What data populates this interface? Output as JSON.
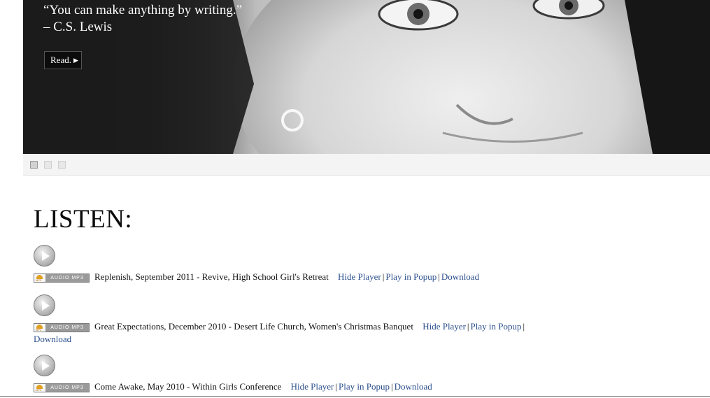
{
  "hero": {
    "quote": "“You can make anything by writing.”",
    "author": "– C.S. Lewis",
    "read_label": "Read.",
    "read_icon": "triangle-right-icon"
  },
  "slider": {
    "dots": [
      {
        "active": true
      },
      {
        "active": false
      },
      {
        "active": false
      }
    ]
  },
  "listen": {
    "title": "LISTEN:",
    "badge_text": "AUDIO MP3",
    "tracks": [
      {
        "title": "Replenish, September 2011 - Revive, High School Girl's Retreat",
        "hide_player": "Hide Player",
        "play_popup": "Play in Popup",
        "download": "Download"
      },
      {
        "title": "Great Expectations, December 2010 - Desert Life Church, Women's Christmas Banquet",
        "hide_player": "Hide Player",
        "play_popup": "Play in Popup",
        "download": "Download"
      },
      {
        "title": "Come Awake, May 2010 - Within Girls Conference",
        "hide_player": "Hide Player",
        "play_popup": "Play in Popup",
        "download": "Download"
      }
    ]
  },
  "colors": {
    "link": "#2b4f8c",
    "text": "#111111"
  }
}
